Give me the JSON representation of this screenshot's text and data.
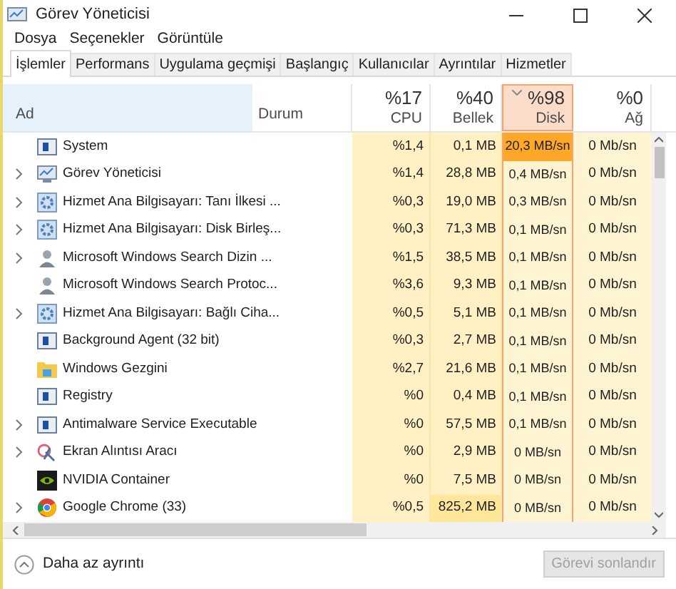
{
  "window": {
    "title": "Görev Yöneticisi"
  },
  "menu": [
    "Dosya",
    "Seçenekler",
    "Görüntüle"
  ],
  "tabs": [
    {
      "label": "İşlemler",
      "selected": true
    },
    {
      "label": "Performans",
      "selected": false
    },
    {
      "label": "Uygulama geçmişi",
      "selected": false
    },
    {
      "label": "Başlangıç",
      "selected": false
    },
    {
      "label": "Kullanıcılar",
      "selected": false
    },
    {
      "label": "Ayrıntılar",
      "selected": false
    },
    {
      "label": "Hizmetler",
      "selected": false
    }
  ],
  "columns": {
    "name": "Ad",
    "status": "Durum",
    "cpu": {
      "total": "%17",
      "label": "CPU"
    },
    "memory": {
      "total": "%40",
      "label": "Bellek"
    },
    "disk": {
      "total": "%98",
      "label": "Disk",
      "sorted": true
    },
    "network": {
      "total": "%0",
      "label": "Ağ"
    }
  },
  "rows": [
    {
      "kind": "system",
      "name": "System",
      "expandable": false,
      "cpu": "%1,4",
      "memory": "0,1 MB",
      "disk": "20,3 MB/sn",
      "disk_high": true,
      "network": "0 Mb/sn"
    },
    {
      "kind": "taskmgr",
      "name": "Görev Yöneticisi",
      "expandable": true,
      "cpu": "%1,4",
      "memory": "28,8 MB",
      "disk": "0,4 MB/sn",
      "disk_high": false,
      "network": "0 Mb/sn"
    },
    {
      "kind": "gear",
      "name": "Hizmet Ana Bilgisayarı: Tanı İlkesi ...",
      "expandable": true,
      "cpu": "%0,3",
      "memory": "19,0 MB",
      "disk": "0,3 MB/sn",
      "disk_high": false,
      "network": "0 Mb/sn"
    },
    {
      "kind": "gear",
      "name": "Hizmet Ana Bilgisayarı: Disk Birleş...",
      "expandable": true,
      "cpu": "%0,3",
      "memory": "71,3 MB",
      "disk": "0,1 MB/sn",
      "disk_high": false,
      "network": "0 Mb/sn"
    },
    {
      "kind": "search",
      "name": "Microsoft Windows Search Dizin ...",
      "expandable": true,
      "cpu": "%1,5",
      "memory": "38,5 MB",
      "disk": "0,1 MB/sn",
      "disk_high": false,
      "network": "0 Mb/sn"
    },
    {
      "kind": "search",
      "name": "Microsoft Windows Search Protoc...",
      "expandable": false,
      "cpu": "%3,6",
      "memory": "9,3 MB",
      "disk": "0,1 MB/sn",
      "disk_high": false,
      "network": "0 Mb/sn"
    },
    {
      "kind": "gear",
      "name": "Hizmet Ana Bilgisayarı: Bağlı Ciha...",
      "expandable": true,
      "cpu": "%0,5",
      "memory": "5,1 MB",
      "disk": "0,1 MB/sn",
      "disk_high": false,
      "network": "0 Mb/sn"
    },
    {
      "kind": "system",
      "name": "Background Agent (32 bit)",
      "expandable": false,
      "cpu": "%0,3",
      "memory": "2,7 MB",
      "disk": "0,1 MB/sn",
      "disk_high": false,
      "network": "0 Mb/sn"
    },
    {
      "kind": "folder",
      "name": "Windows Gezgini",
      "expandable": false,
      "cpu": "%2,7",
      "memory": "21,6 MB",
      "disk": "0,1 MB/sn",
      "disk_high": false,
      "network": "0 Mb/sn"
    },
    {
      "kind": "system",
      "name": "Registry",
      "expandable": false,
      "cpu": "%0",
      "memory": "0,4 MB",
      "disk": "0,1 MB/sn",
      "disk_high": false,
      "network": "0 Mb/sn"
    },
    {
      "kind": "system",
      "name": "Antimalware Service Executable",
      "expandable": true,
      "cpu": "%0",
      "memory": "57,5 MB",
      "disk": "0,1 MB/sn",
      "disk_high": false,
      "network": "0 Mb/sn"
    },
    {
      "kind": "snip",
      "name": "Ekran Alıntısı Aracı",
      "expandable": true,
      "cpu": "%0",
      "memory": "2,9 MB",
      "disk": "0 MB/sn",
      "disk_high": false,
      "network": "0 Mb/sn"
    },
    {
      "kind": "nvidia",
      "name": "NVIDIA Container",
      "expandable": false,
      "cpu": "%0",
      "memory": "7,5 MB",
      "disk": "0 MB/sn",
      "disk_high": false,
      "network": "0 Mb/sn"
    },
    {
      "kind": "chrome",
      "name": "Google Chrome (33)",
      "expandable": true,
      "cpu": "%0,5",
      "memory": "825,2 MB",
      "disk": "0 MB/sn",
      "disk_high": false,
      "network": "0 Mb/sn"
    }
  ],
  "footer": {
    "toggle": "Daha az ayrıntı",
    "end_task": {
      "label": "Görevi sonlandır",
      "disabled": true
    }
  }
}
